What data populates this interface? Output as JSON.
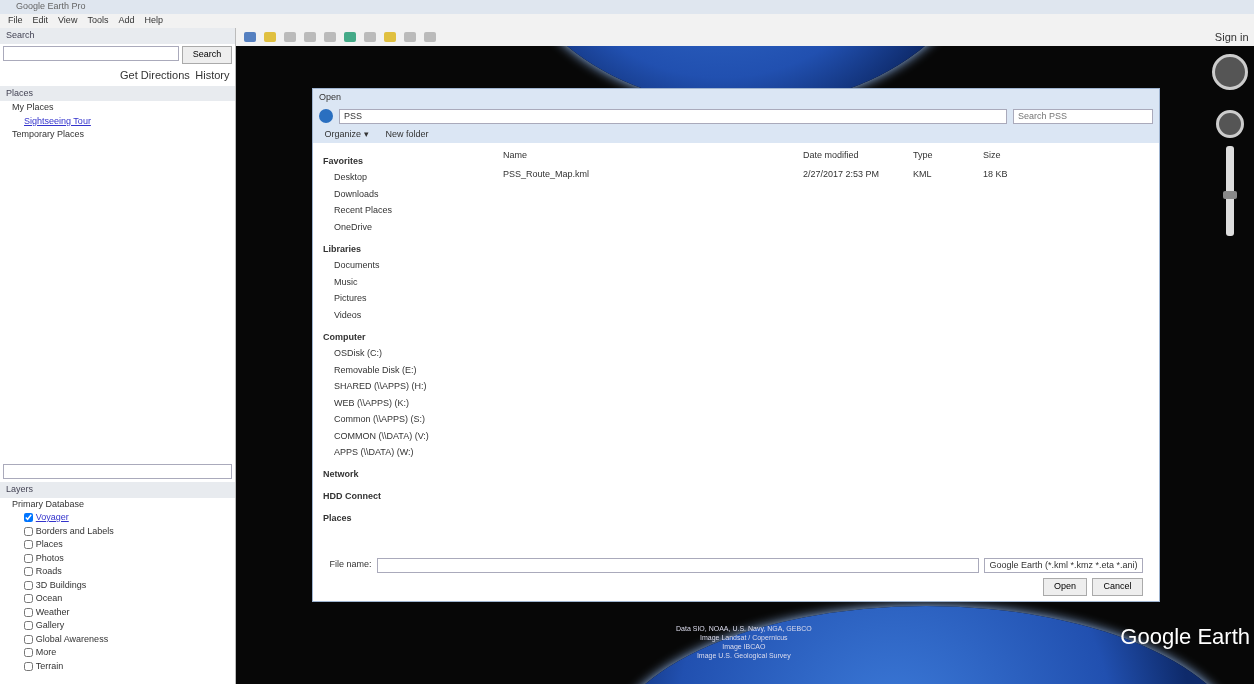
{
  "window": {
    "title": "Google Earth Pro"
  },
  "menu": [
    "File",
    "Edit",
    "View",
    "Tools",
    "Add",
    "Help"
  ],
  "search": {
    "header": "Search",
    "button": "Search",
    "links": [
      "Get Directions",
      "History"
    ]
  },
  "places": {
    "header": "Places",
    "items": [
      {
        "label": "My Places",
        "link": false,
        "children": [
          {
            "label": "Sightseeing Tour",
            "link": true
          }
        ]
      },
      {
        "label": "Temporary Places",
        "link": false
      }
    ]
  },
  "layers": {
    "header": "Layers",
    "root": "Primary Database",
    "items": [
      {
        "label": "Voyager",
        "link": true,
        "checked": true
      },
      {
        "label": "Borders and Labels",
        "link": false,
        "checked": false
      },
      {
        "label": "Places",
        "link": false,
        "checked": false
      },
      {
        "label": "Photos",
        "link": false,
        "checked": false
      },
      {
        "label": "Roads",
        "link": false,
        "checked": false
      },
      {
        "label": "3D Buildings",
        "link": false,
        "checked": false
      },
      {
        "label": "Ocean",
        "link": false,
        "checked": false
      },
      {
        "label": "Weather",
        "link": false,
        "checked": false
      },
      {
        "label": "Gallery",
        "link": false,
        "checked": false
      },
      {
        "label": "Global Awareness",
        "link": false,
        "checked": false
      },
      {
        "label": "More",
        "link": false,
        "checked": false
      },
      {
        "label": "Terrain",
        "link": false,
        "checked": false
      }
    ]
  },
  "signin": "Sign in",
  "zoom": {
    "level": 0.45
  },
  "dialog": {
    "title": "Open",
    "path": "PSS",
    "search_placeholder": "Search PSS",
    "toolbar": [
      "Organize ▾",
      "New folder"
    ],
    "nav": [
      {
        "label": "Favorites",
        "kind": "header"
      },
      {
        "label": "Desktop",
        "kind": "item"
      },
      {
        "label": "Downloads",
        "kind": "item"
      },
      {
        "label": "Recent Places",
        "kind": "item"
      },
      {
        "label": "OneDrive",
        "kind": "item"
      },
      {
        "label": "Libraries",
        "kind": "header"
      },
      {
        "label": "Documents",
        "kind": "item"
      },
      {
        "label": "Music",
        "kind": "item"
      },
      {
        "label": "Pictures",
        "kind": "item"
      },
      {
        "label": "Videos",
        "kind": "item"
      },
      {
        "label": "Computer",
        "kind": "header"
      },
      {
        "label": "OSDisk (C:)",
        "kind": "item"
      },
      {
        "label": "Removable Disk (E:)",
        "kind": "item"
      },
      {
        "label": "SHARED (\\\\APPS) (H:)",
        "kind": "item"
      },
      {
        "label": "WEB (\\\\APPS) (K:)",
        "kind": "item"
      },
      {
        "label": "Common (\\\\APPS) (S:)",
        "kind": "item"
      },
      {
        "label": "COMMON (\\\\DATA) (V:)",
        "kind": "item"
      },
      {
        "label": "APPS (\\\\DATA) (W:)",
        "kind": "item"
      },
      {
        "label": "Network",
        "kind": "header"
      },
      {
        "label": "HDD Connect",
        "kind": "header"
      },
      {
        "label": "Places",
        "kind": "header"
      }
    ],
    "columns": [
      "Name",
      "Date modified",
      "Type",
      "Size"
    ],
    "files": [
      {
        "name": "PSS_Route_Map.kml",
        "date": "2/27/2017 2:53 PM",
        "type": "KML",
        "size": "18 KB"
      }
    ],
    "filename_label": "File name:",
    "filter": "Google Earth (*.kml *.kmz *.eta *.ani)",
    "buttons": [
      "Open",
      "Cancel"
    ]
  },
  "attribution": [
    "Data SIO, NOAA, U.S. Navy, NGA, GEBCO",
    "Image Landsat / Copernicus",
    "Image IBCAO",
    "Image U.S. Geological Survey"
  ],
  "logo": "Google Earth"
}
